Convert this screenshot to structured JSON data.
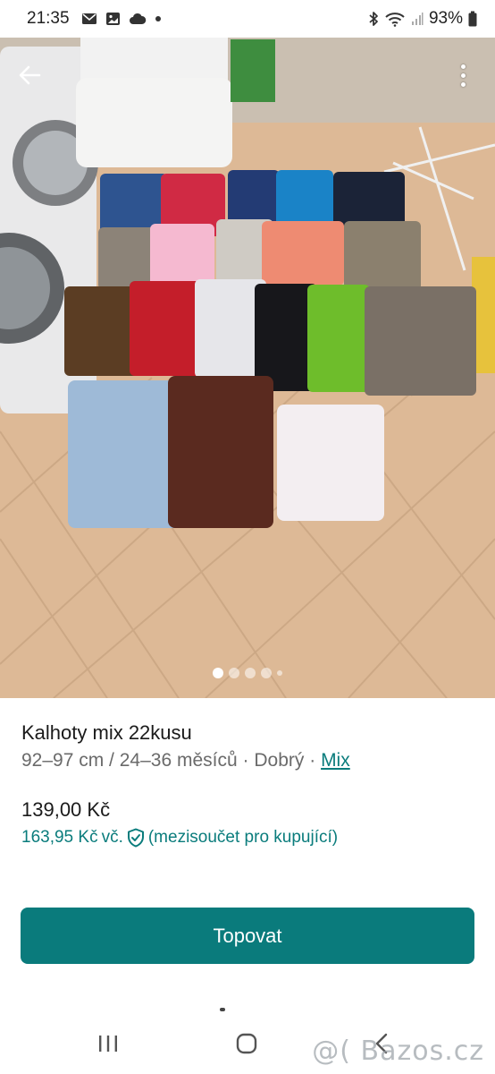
{
  "status_bar": {
    "time": "21:35",
    "battery": "93%",
    "icons": [
      "mail-icon",
      "image-icon",
      "cloud-icon",
      "dot-icon",
      "bluetooth-icon",
      "wifi-icon",
      "signal-icon",
      "battery-icon"
    ]
  },
  "photo": {
    "description_icons": [
      "back-arrow-icon",
      "more-vertical-icon"
    ],
    "carousel": {
      "count": 5,
      "active_index": 0
    }
  },
  "listing": {
    "title": "Kalhoty mix 22kusu",
    "size": "92–97 cm / 24–36 měsíců",
    "separator": "·",
    "condition": "Dobrý",
    "brand": "Mix",
    "price": "139,00 Kč",
    "price_total": "163,95 Kč",
    "price_total_suffix": "vč.",
    "price_total_note": "(mezisoučet pro kupující)"
  },
  "actions": {
    "topovat_label": "Topovat"
  },
  "system_nav": {
    "watermark": "@( Bazos.cz"
  },
  "colors": {
    "accent": "#0a7b7c",
    "link": "#0a7c7c",
    "subtitle": "#6a6a6a"
  }
}
